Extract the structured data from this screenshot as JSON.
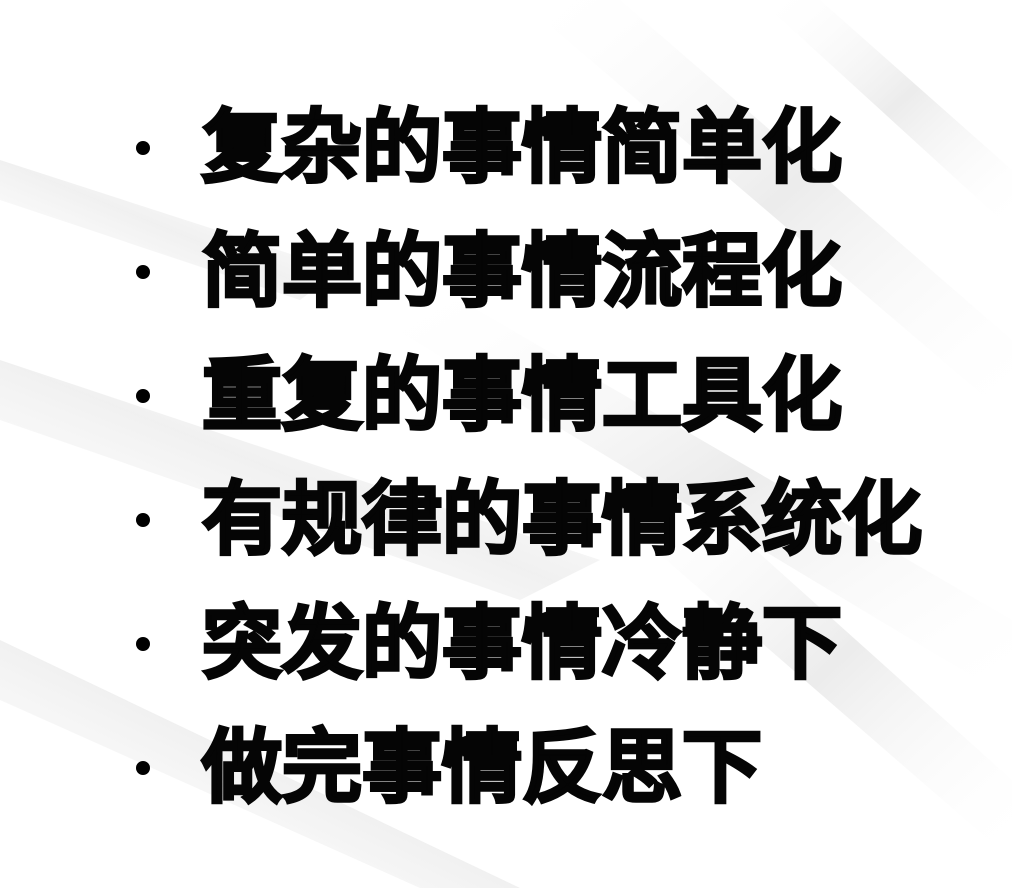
{
  "colors": {
    "background": "#ffffff",
    "text": "#050505",
    "bullet": "#000000",
    "streak": "#e9e9e9"
  },
  "items": [
    {
      "text": "复杂的事情简单化"
    },
    {
      "text": "简单的事情流程化"
    },
    {
      "text": "重复的事情工具化"
    },
    {
      "text": "有规律的事情系统化"
    },
    {
      "text": "突发的事情冷静下"
    },
    {
      "text": "做完事情反思下"
    }
  ]
}
